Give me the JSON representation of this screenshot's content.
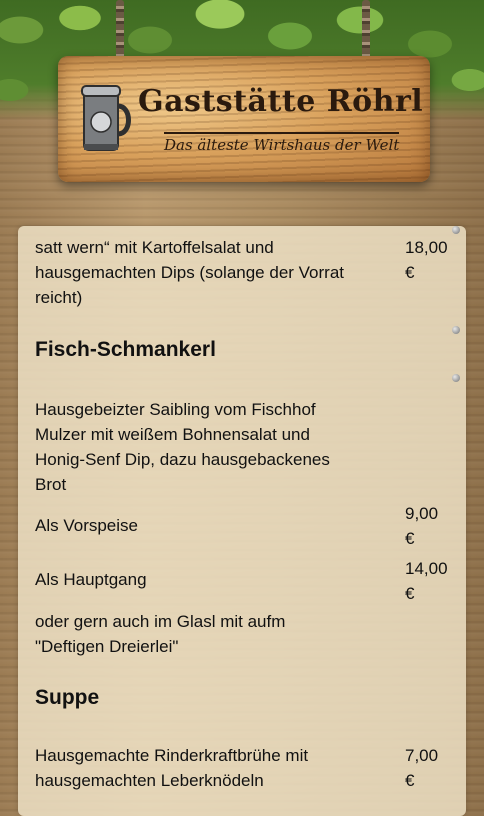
{
  "header": {
    "title": "Gaststätte Röhrl",
    "subtitle": "Das älteste Wirtshaus der Welt"
  },
  "menu": {
    "item_top": {
      "lines": [
        "satt wern“ mit Kartoffelsalat und",
        "hausgemachten Dips (solange der Vorrat",
        "reicht)"
      ],
      "price": [
        "18,00",
        "€"
      ]
    },
    "section_fish": "Fisch-Schmankerl",
    "fish_desc": [
      "Hausgebeizter Saibling vom Fischhof",
      "Mulzer mit weißem Bohnensalat und",
      "Honig-Senf Dip, dazu hausgebackenes",
      "Brot"
    ],
    "starter": {
      "label": "Als Vorspeise",
      "price": [
        "9,00",
        "€"
      ]
    },
    "main": {
      "label": "Als Hauptgang",
      "price": [
        "14,00",
        "€"
      ]
    },
    "glas_note": [
      "oder gern auch im Glasl mit aufm",
      "\"Deftigen Dreierlei\""
    ],
    "section_soup": "Suppe",
    "soup": {
      "lines": [
        "Hausgemachte Rinderkraftbrühe mit",
        "hausgemachten Leberknödeln"
      ],
      "price": [
        "7,00",
        "€"
      ]
    }
  },
  "colors": {
    "panel": "#ece0c4",
    "text": "#111111",
    "leaves": "#6c9a3a",
    "sign": "#d9a15c"
  }
}
